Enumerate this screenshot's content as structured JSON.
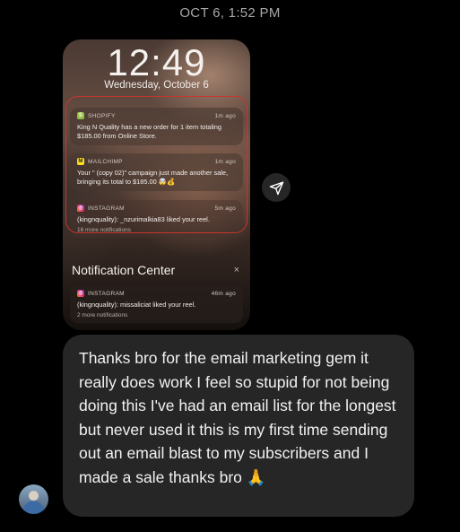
{
  "header": {
    "timestamp": "OCT 6, 1:52 PM"
  },
  "screenshot": {
    "clock": "12:49",
    "date": "Wednesday, October 6",
    "notifications": [
      {
        "app": "SHOPIFY",
        "ago": "1m ago",
        "body": "King N Quality has a new order for 1 item totaling $185.00 from Online Store.",
        "icon": "shopify-icon",
        "color": "#95bf47"
      },
      {
        "app": "MAILCHIMP",
        "ago": "1m ago",
        "body": "Your \" (copy 02)\" campaign just made another sale, bringing its total to $185.00 🤯💰",
        "icon": "mailchimp-icon",
        "color": "#ffe01b"
      },
      {
        "app": "INSTAGRAM",
        "ago": "5m ago",
        "body": "(kingnquality): _nzurimalkia83 liked your reel.",
        "more": "16 more notifications",
        "icon": "instagram-icon",
        "color": "#d6249f"
      }
    ],
    "notification_center": {
      "title": "Notification Center",
      "close": "×",
      "items": [
        {
          "app": "INSTAGRAM",
          "ago": "46m ago",
          "body": "(kingnquality): missaliciat liked your reel.",
          "more": "2 more notifications",
          "icon": "instagram-icon",
          "color": "#d6249f"
        }
      ]
    }
  },
  "message": {
    "text": "Thanks bro for the email marketing gem it really does work I feel so stupid for not being doing this I've had an email list for the longest but never used it this is my first time sending out an email blast to my subscribers and I made a sale thanks bro 🙏"
  },
  "colors": {
    "background": "#000000",
    "bubble": "#262626",
    "highlight": "#c8352e"
  }
}
